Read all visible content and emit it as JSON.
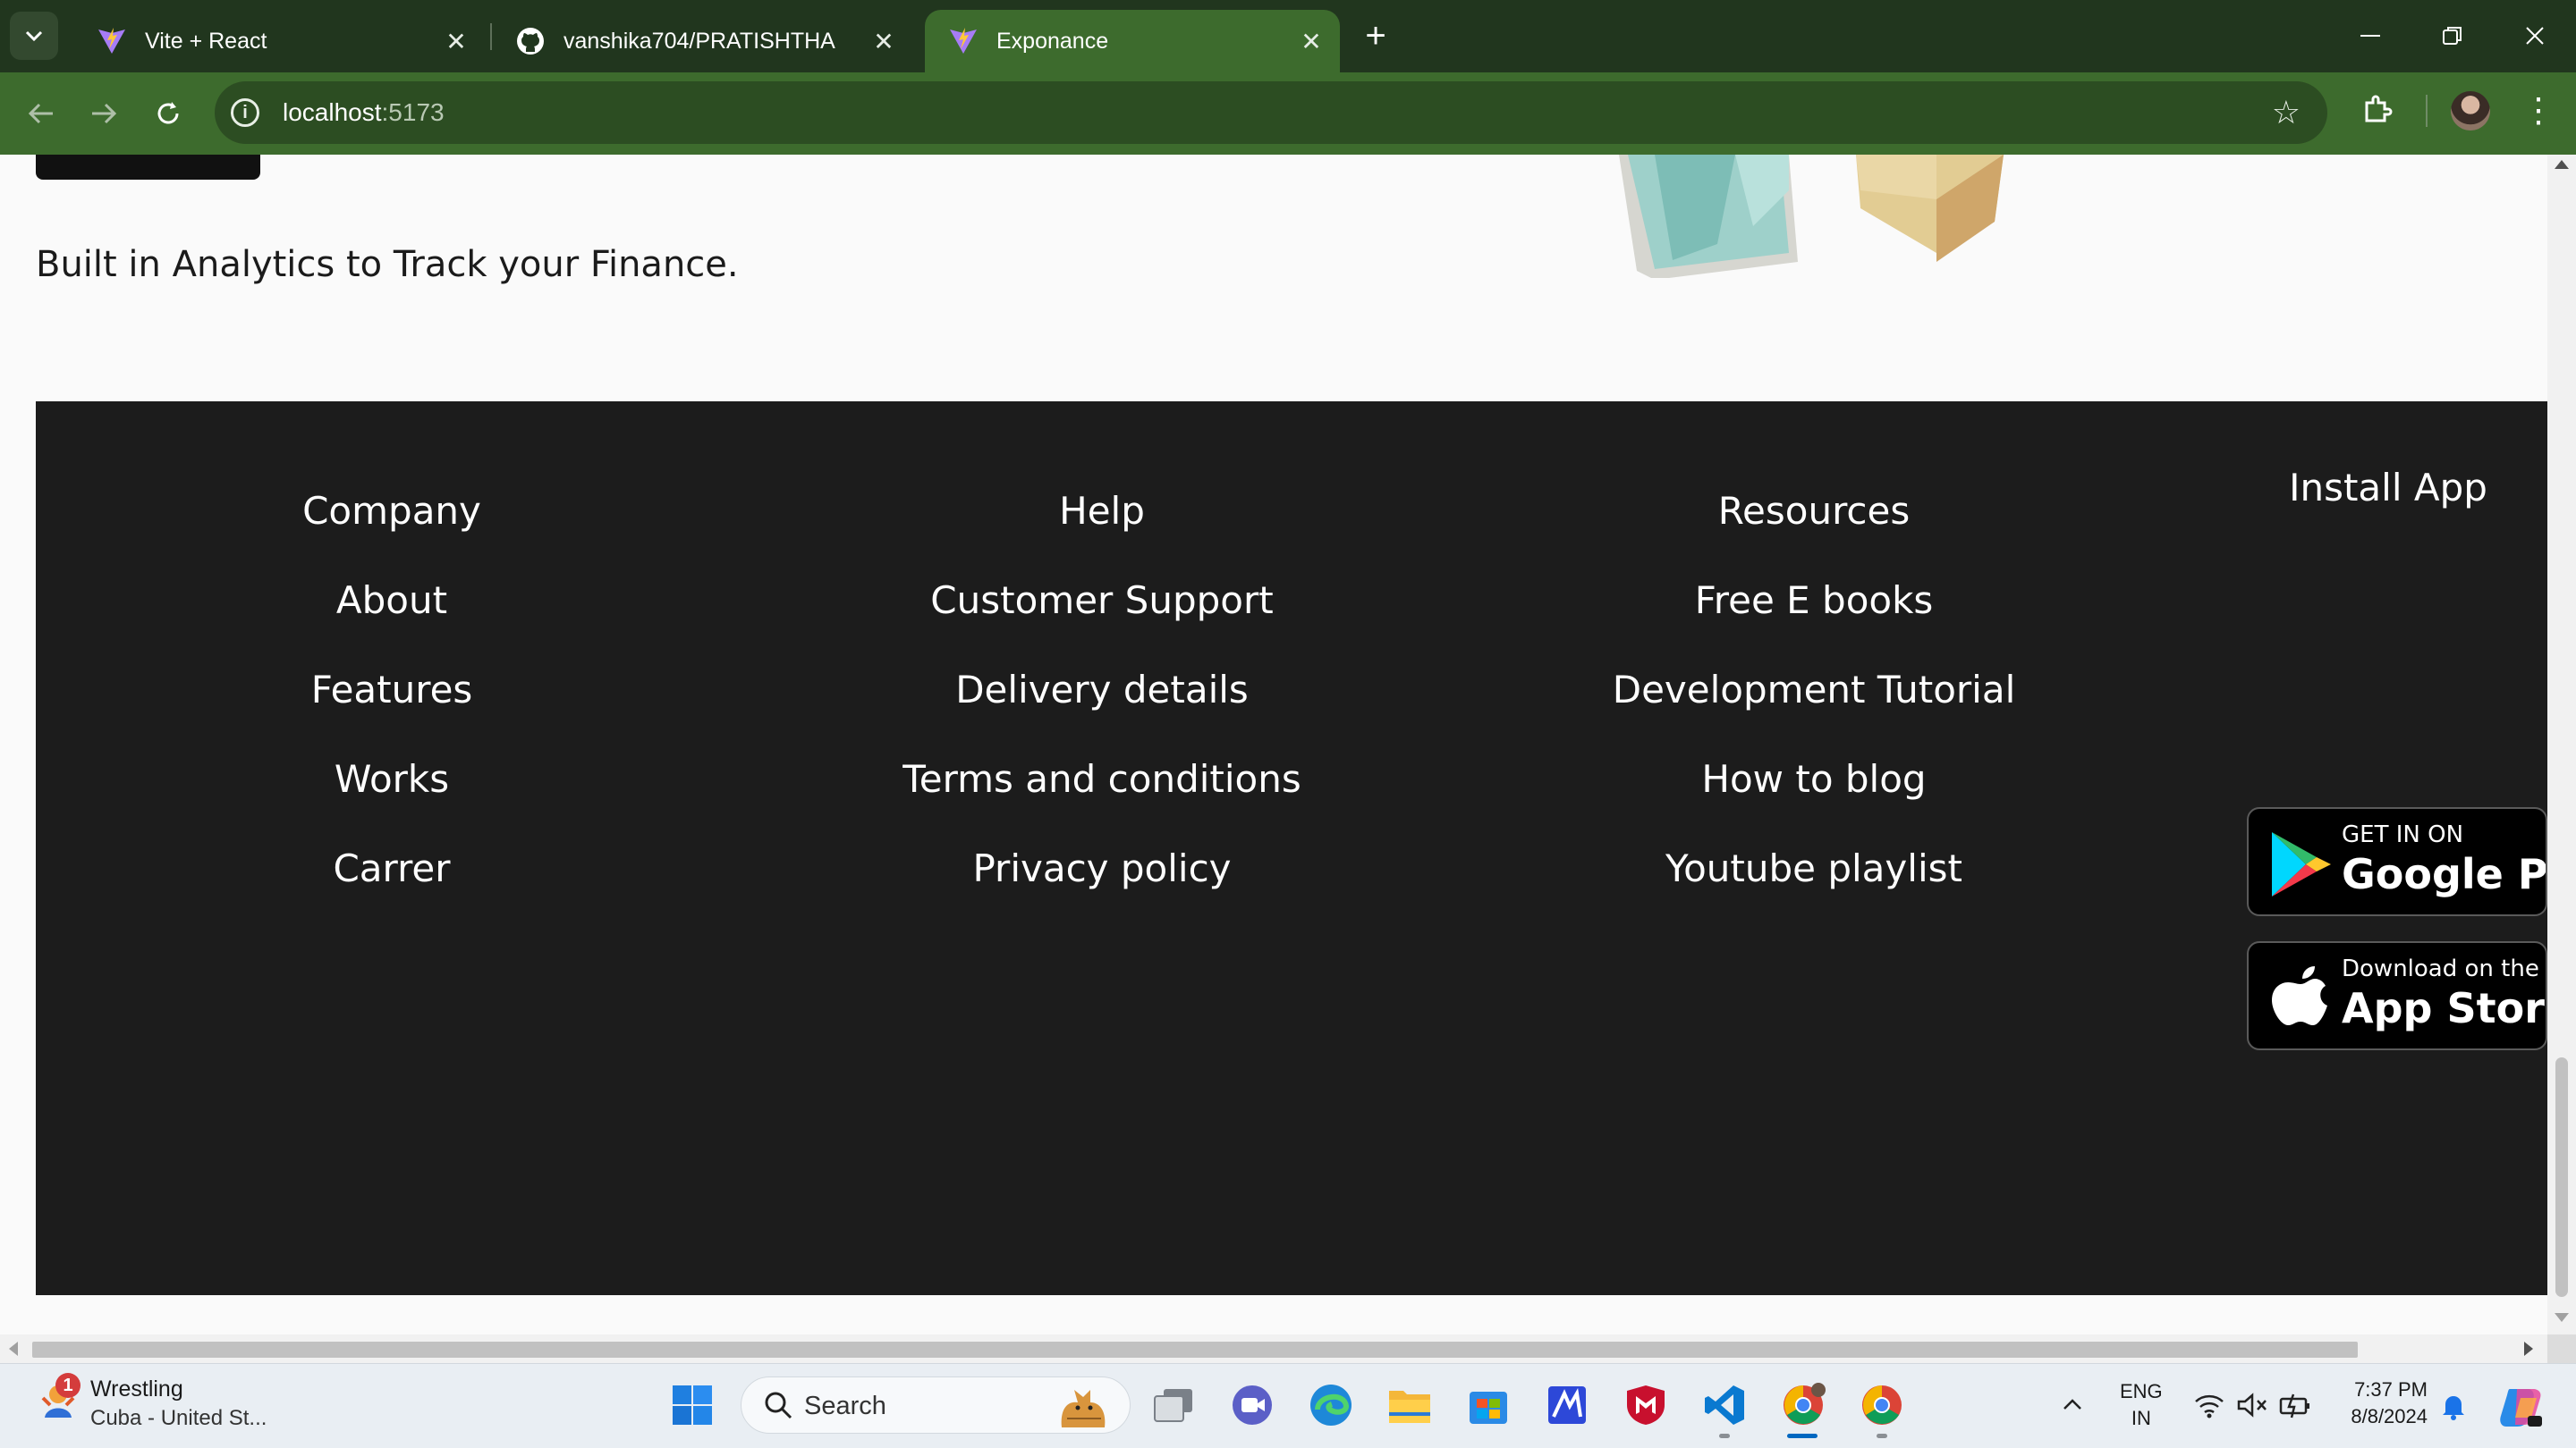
{
  "browser": {
    "tabs": [
      {
        "title": "Vite + React",
        "active": false
      },
      {
        "title": "vanshika704/PRATISHTHA",
        "active": false
      },
      {
        "title": "Exponance",
        "active": true
      }
    ],
    "url_host": "localhost",
    "url_port": ":5173"
  },
  "page": {
    "hero_text": "Built in Analytics to Track your Finance.",
    "footer": {
      "columns": [
        {
          "heading": "Company",
          "items": [
            "About",
            "Features",
            "Works",
            "Carrer"
          ]
        },
        {
          "heading": "Help",
          "items": [
            "Customer Support",
            "Delivery details",
            "Terms and conditions",
            "Privacy policy"
          ]
        },
        {
          "heading": "Resources",
          "items": [
            "Free E books",
            "Development Tutorial",
            "How to blog",
            "Youtube playlist"
          ]
        }
      ],
      "install_heading": "Install App",
      "google_play": {
        "small": "GET IN ON",
        "big": "Google Play"
      },
      "app_store": {
        "small": "Download on the",
        "big": "App Store"
      }
    }
  },
  "taskbar": {
    "weather_badge": "1",
    "weather_title": "Wrestling",
    "weather_subtitle": "Cuba - United St...",
    "search_label": "Search",
    "lang_primary": "ENG",
    "lang_secondary": "IN",
    "time": "7:37 PM",
    "date": "8/8/2024"
  },
  "colors": {
    "chrome_dark": "#21361e",
    "chrome_accent": "#3d6b2d",
    "footer_bg": "#1c1c1c",
    "page_bg": "#fafafa"
  }
}
